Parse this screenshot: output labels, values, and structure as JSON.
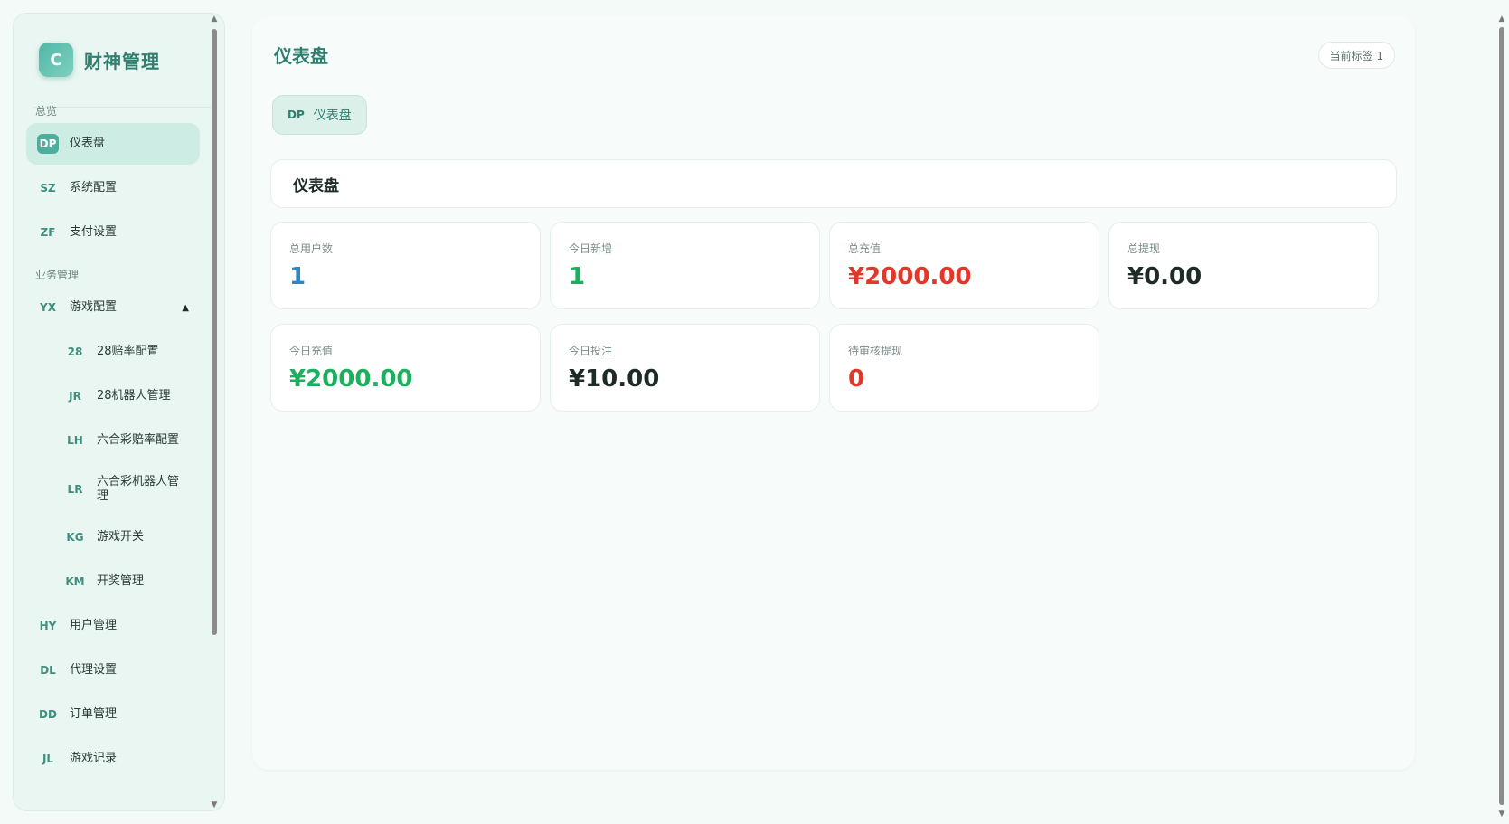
{
  "brand": {
    "logo_letter": "C",
    "name": "财神管理"
  },
  "sidebar": {
    "sections": [
      {
        "label": "总览"
      },
      {
        "label": "业务管理"
      }
    ],
    "items": [
      {
        "code": "DP",
        "label": "仪表盘",
        "active": true
      },
      {
        "code": "SZ",
        "label": "系统配置"
      },
      {
        "code": "ZF",
        "label": "支付设置"
      },
      {
        "code": "YX",
        "label": "游戏配置",
        "expanded": true,
        "caret": "▲"
      },
      {
        "code": "28",
        "label": "28赔率配置"
      },
      {
        "code": "JR",
        "label": "28机器人管理"
      },
      {
        "code": "LH",
        "label": "六合彩赔率配置"
      },
      {
        "code": "LR",
        "label": "六合彩机器人管理"
      },
      {
        "code": "KG",
        "label": "游戏开关"
      },
      {
        "code": "KM",
        "label": "开奖管理"
      },
      {
        "code": "HY",
        "label": "用户管理"
      },
      {
        "code": "DL",
        "label": "代理设置"
      },
      {
        "code": "DD",
        "label": "订单管理"
      },
      {
        "code": "JL",
        "label": "游戏记录"
      }
    ]
  },
  "header": {
    "title": "仪表盘",
    "tag_badge": "当前标签 1"
  },
  "tabs": [
    {
      "code": "DP",
      "label": "仪表盘"
    }
  ],
  "section": {
    "title": "仪表盘"
  },
  "stats": [
    {
      "label": "总用户数",
      "value": "1",
      "color": "#2e86c9"
    },
    {
      "label": "今日新增",
      "value": "1",
      "color": "#1fae5f"
    },
    {
      "label": "总充值",
      "value": "¥2000.00",
      "color": "#e0392b"
    },
    {
      "label": "总提现",
      "value": "¥0.00",
      "color": "#1e2b28"
    },
    {
      "label": "今日充值",
      "value": "¥2000.00",
      "color": "#1fae5f"
    },
    {
      "label": "今日投注",
      "value": "¥10.00",
      "color": "#1e2b28"
    },
    {
      "label": "待审核提现",
      "value": "0",
      "color": "#e0392b"
    }
  ],
  "colors": {
    "accent": "#2f7f6f",
    "sidebar_bg": "#eaf6f2",
    "active_item_bg": "#cdece4"
  }
}
